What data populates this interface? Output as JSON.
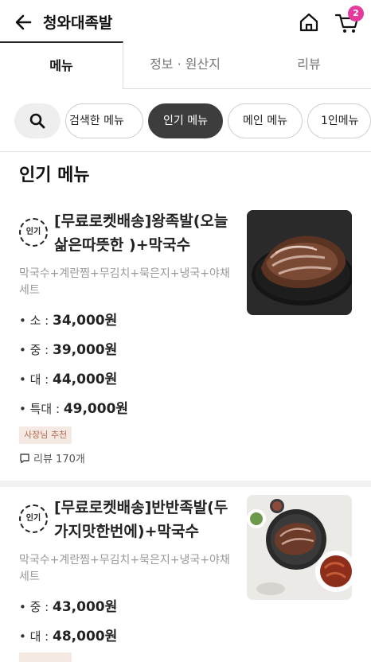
{
  "header": {
    "title": "청와대족발",
    "cart_count": "2"
  },
  "tabs": [
    "메뉴",
    "정보 · 원산지",
    "리뷰"
  ],
  "chips": [
    "검색한 메뉴",
    "인기 메뉴",
    "메인 메뉴",
    "1인메뉴"
  ],
  "section_title": "인기 메뉴",
  "items": [
    {
      "badge": "인기",
      "name_line1": "[무료로켓배송]왕족발(오늘",
      "name_line2": "삶은따뜻한 )+막국수",
      "desc_line1": "막국수+계란찜+무김치+묵은지+냉국+야채",
      "desc_line2": "세트",
      "prices": [
        {
          "label": "• 소 : ",
          "amount": "34,000원"
        },
        {
          "label": "• 중 : ",
          "amount": "39,000원"
        },
        {
          "label": "• 대 : ",
          "amount": "44,000원"
        },
        {
          "label": "• 특대 : ",
          "amount": "49,000원"
        }
      ],
      "recommend": "사장님 추천",
      "review": "리뷰 170개"
    },
    {
      "badge": "인기",
      "name_line1": "[무료로켓배송]반반족발(두",
      "name_line2": "가지맛한번에)+막국수",
      "desc_line1": "막국수+계란찜+무김치+묵은지+냉국+야채",
      "desc_line2": "세트",
      "prices": [
        {
          "label": "• 중 : ",
          "amount": "43,000원"
        },
        {
          "label": "• 대 : ",
          "amount": "48,000원"
        }
      ]
    }
  ]
}
